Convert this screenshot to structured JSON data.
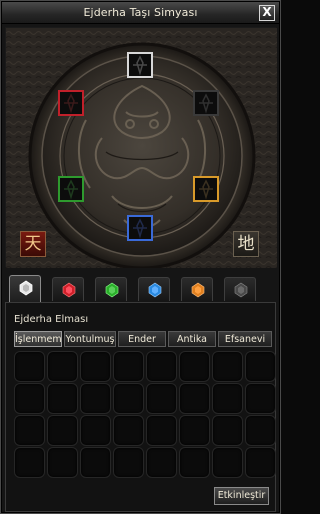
{
  "window": {
    "title": "Ejderha Taşı Simyası",
    "close_label": "X"
  },
  "disc": {
    "slots": [
      {
        "name": "white",
        "color": "#d8d8d8"
      },
      {
        "name": "black",
        "color": "#4a4a4a"
      },
      {
        "name": "yellow",
        "color": "#d89a2a"
      },
      {
        "name": "blue",
        "color": "#3a6ad8"
      },
      {
        "name": "green",
        "color": "#2e9a2e"
      },
      {
        "name": "red",
        "color": "#c0202a"
      }
    ],
    "seal_heaven": "天",
    "seal_earth": "地"
  },
  "tabs": [
    {
      "name": "diamond",
      "color": "#e8e8e8"
    },
    {
      "name": "ruby",
      "color": "#d0202a"
    },
    {
      "name": "jade",
      "color": "#2ab02a"
    },
    {
      "name": "sapphire",
      "color": "#2a8ae0"
    },
    {
      "name": "garnet",
      "color": "#e08020"
    },
    {
      "name": "onyx",
      "color": "#5a5a5a"
    }
  ],
  "panel": {
    "section_label": "Ejderha Elması",
    "sub_tabs": [
      "İşlenmemiş",
      "Yontulmuş",
      "Ender",
      "Antika",
      "Efsanevi"
    ],
    "activate_label": "Etkinleştir"
  },
  "colors": {
    "accent": "#8a8a8a",
    "disc_base": "#2e2a26"
  }
}
